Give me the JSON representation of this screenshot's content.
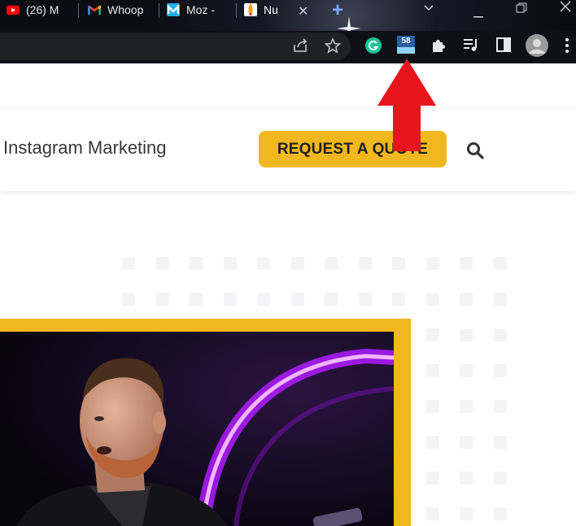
{
  "browser": {
    "tabs": [
      {
        "label": "(26) M",
        "icon": "youtube-icon"
      },
      {
        "label": "Whoop",
        "icon": "gmail-icon"
      },
      {
        "label": "Moz -",
        "icon": "moz-icon"
      },
      {
        "label": "Nu",
        "icon": "rocket-icon",
        "active": true
      }
    ],
    "new_tab": "+",
    "close_tab": "✕",
    "extension_badge": "58"
  },
  "header": {
    "nav_label": "Instagram Marketing",
    "cta_label": "REQUEST A QUOTE"
  },
  "annotation": {
    "color": "#e8141c"
  },
  "colors": {
    "accent": "#f0b81e",
    "purple": "#a020f0"
  }
}
